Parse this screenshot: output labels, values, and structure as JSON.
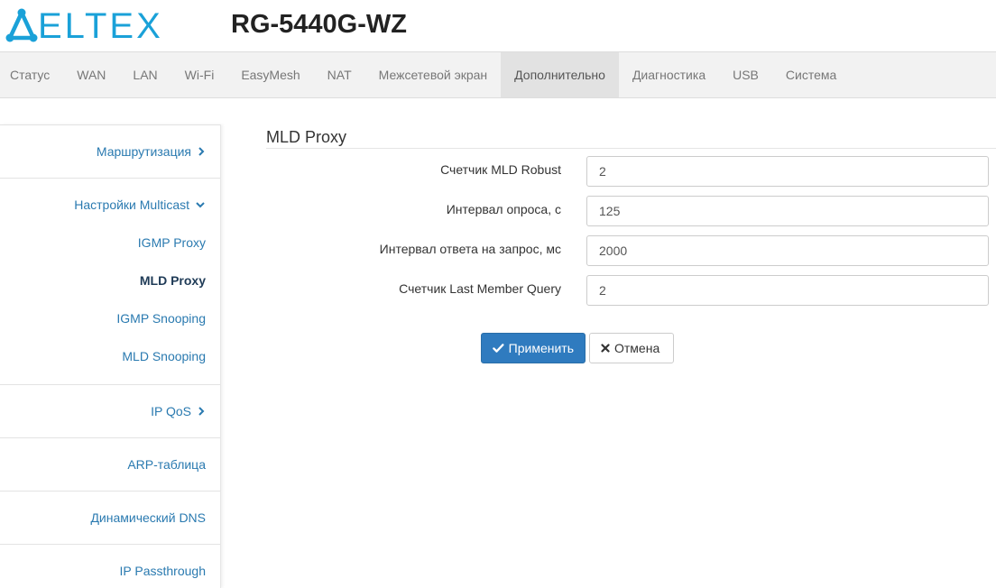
{
  "header": {
    "logo_text": "ELTEX",
    "device_model": "RG-5440G-WZ"
  },
  "topnav": {
    "tabs": [
      {
        "label": "Статус"
      },
      {
        "label": "WAN"
      },
      {
        "label": "LAN"
      },
      {
        "label": "Wi-Fi"
      },
      {
        "label": "EasyMesh"
      },
      {
        "label": "NAT"
      },
      {
        "label": "Межсетевой экран"
      },
      {
        "label": "Дополнительно",
        "active": true
      },
      {
        "label": "Диагностика"
      },
      {
        "label": "USB"
      },
      {
        "label": "Система"
      }
    ]
  },
  "sidebar": {
    "routing": "Маршрутизация",
    "multicast": "Настройки Multicast",
    "multicast_items": [
      {
        "label": "IGMP Proxy"
      },
      {
        "label": "MLD Proxy",
        "active": true
      },
      {
        "label": "IGMP Snooping"
      },
      {
        "label": "MLD Snooping"
      }
    ],
    "ipqos": "IP QoS",
    "arp": "ARP-таблица",
    "ddns": "Динамический DNS",
    "passthrough": "IP Passthrough"
  },
  "main": {
    "title": "MLD Proxy",
    "fields": [
      {
        "label": "Счетчик MLD Robust",
        "value": "2"
      },
      {
        "label": "Интервал опроса, с",
        "value": "125"
      },
      {
        "label": "Интервал ответа на запрос, мс",
        "value": "2000"
      },
      {
        "label": "Счетчик Last Member Query",
        "value": "2"
      }
    ],
    "apply_label": "Применить",
    "cancel_label": "Отмена"
  },
  "colors": {
    "brand": "#1aa1d8",
    "link": "#2a7ab0",
    "primary_button": "#2f7bbf"
  }
}
